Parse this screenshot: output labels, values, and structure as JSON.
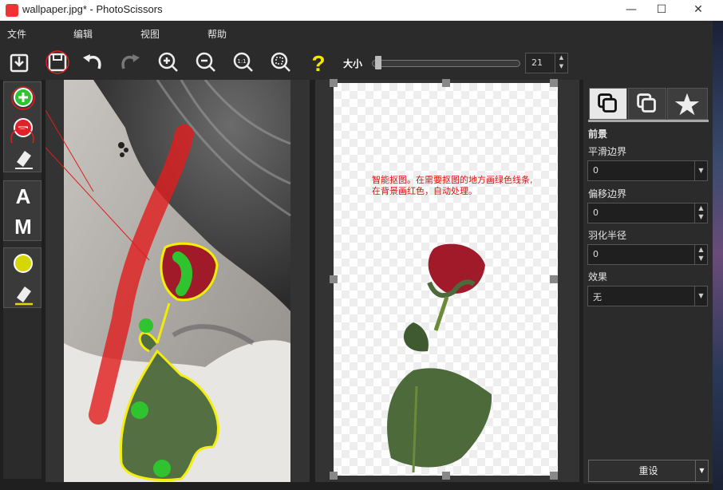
{
  "window": {
    "title": "wallpaper.jpg* - PhotoScissors",
    "minimize": "—",
    "maximize": "☐",
    "close": "✕"
  },
  "menu": [
    "文件",
    "编辑",
    "视图",
    "帮助"
  ],
  "toolbar": {
    "buttons": [
      {
        "name": "open",
        "icon": "open-icon"
      },
      {
        "name": "save",
        "icon": "save-icon"
      },
      {
        "name": "undo",
        "icon": "undo-icon"
      },
      {
        "name": "redo",
        "icon": "redo-icon"
      },
      {
        "name": "zoom-in",
        "icon": "zoom-in-icon"
      },
      {
        "name": "zoom-out",
        "icon": "zoom-out-icon"
      },
      {
        "name": "actual-size",
        "icon": "actual-size-icon",
        "text": "1:1"
      },
      {
        "name": "fit",
        "icon": "fit-icon"
      },
      {
        "name": "help",
        "icon": "help-icon",
        "text": "?"
      }
    ],
    "size_label": "大小",
    "size_value": "21"
  },
  "tools": {
    "mode_a": "A",
    "mode_m": "M"
  },
  "canvas": {
    "hint_line1": "智能抠图。在需要抠图的地方画绿色线条,",
    "hint_line2": "在背景画红色，自动处理。"
  },
  "panel": {
    "section_title": "前景",
    "smooth_label": "平滑边界",
    "smooth_value": "0",
    "offset_label": "偏移边界",
    "offset_value": "0",
    "feather_label": "羽化半径",
    "feather_value": "0",
    "effect_label": "效果",
    "effect_value": "无",
    "reset_label": "重设"
  },
  "colors": {
    "keep_marker": "#2fc42f",
    "remove_marker": "#e0202a",
    "outline": "#f4f000",
    "hint_text": "#d11111"
  }
}
